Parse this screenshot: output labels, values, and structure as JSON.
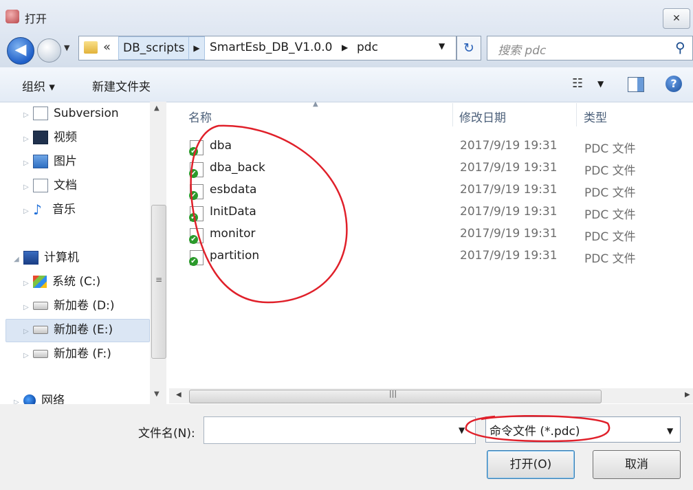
{
  "window": {
    "title": "打开",
    "close_label": "☒"
  },
  "nav": {
    "back_arrow": "◀",
    "breadcrumbs": [
      "DB_scripts",
      "SmartEsb_DB_V1.0.0",
      "pdc"
    ],
    "overflow": "«",
    "search_placeholder": "搜索 pdc"
  },
  "toolbar": {
    "organize_label": "组织 ▾",
    "new_folder_label": "新建文件夹"
  },
  "sidebar": {
    "items": [
      {
        "label": "Subversion",
        "icon": "document-icon"
      },
      {
        "label": "视频",
        "icon": "video-icon"
      },
      {
        "label": "图片",
        "icon": "image-icon"
      },
      {
        "label": "文档",
        "icon": "document-icon"
      },
      {
        "label": "音乐",
        "icon": "music-icon"
      },
      {
        "label": "计算机",
        "icon": "computer-icon"
      },
      {
        "label": "系统 (C:)",
        "icon": "windows-drive-icon"
      },
      {
        "label": "新加卷 (D:)",
        "icon": "drive-icon"
      },
      {
        "label": "新加卷 (E:)",
        "icon": "drive-icon"
      },
      {
        "label": "新加卷 (F:)",
        "icon": "drive-icon"
      },
      {
        "label": "网络",
        "icon": "network-icon"
      }
    ],
    "selected": "新加卷 (E:)"
  },
  "file_list": {
    "columns": [
      "名称",
      "修改日期",
      "类型"
    ],
    "rows": [
      {
        "name": "dba",
        "date": "2017/9/19 19:31",
        "type": "PDC 文件"
      },
      {
        "name": "dba_back",
        "date": "2017/9/19 19:31",
        "type": "PDC 文件"
      },
      {
        "name": "esbdata",
        "date": "2017/9/19 19:31",
        "type": "PDC 文件"
      },
      {
        "name": "InitData",
        "date": "2017/9/19 19:31",
        "type": "PDC 文件"
      },
      {
        "name": "monitor",
        "date": "2017/9/19 19:31",
        "type": "PDC 文件"
      },
      {
        "name": "partition",
        "date": "2017/9/19 19:31",
        "type": "PDC 文件"
      }
    ]
  },
  "bottom": {
    "filename_label": "文件名(N):",
    "filename_value": "",
    "filetype_value": "命令文件 (*.pdc)",
    "open_label": "打开(O)",
    "cancel_label": "取消"
  },
  "colors": {
    "annotation": "#e0202a",
    "selection": "#dbe6f4"
  }
}
